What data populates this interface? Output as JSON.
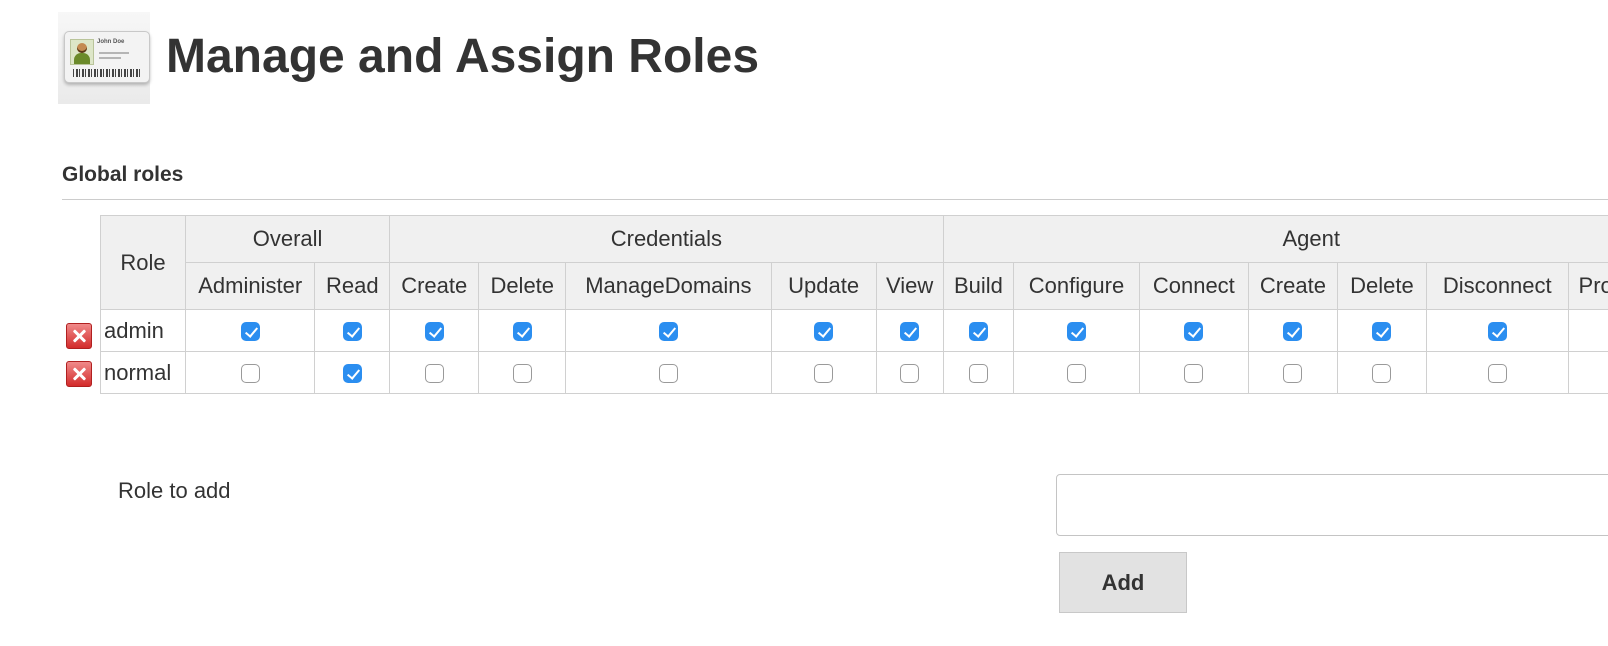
{
  "page": {
    "title": "Manage and Assign Roles"
  },
  "header_icon": {
    "name": "id-card-icon",
    "card_text": "John Doe"
  },
  "global_roles": {
    "title": "Global roles",
    "role_header": "Role",
    "groups": [
      {
        "label": "Overall",
        "span": 2
      },
      {
        "label": "Credentials",
        "span": 5
      },
      {
        "label": "Agent",
        "span": 7
      }
    ],
    "permissions": [
      "Administer",
      "Read",
      "Create",
      "Delete",
      "ManageDomains",
      "Update",
      "View",
      "Build",
      "Configure",
      "Connect",
      "Create",
      "Delete",
      "Disconnect",
      "Provision"
    ],
    "roles": [
      {
        "name": "admin",
        "checked": [
          true,
          true,
          true,
          true,
          true,
          true,
          true,
          true,
          true,
          true,
          true,
          true,
          true,
          true
        ]
      },
      {
        "name": "normal",
        "checked": [
          false,
          true,
          false,
          false,
          false,
          false,
          false,
          false,
          false,
          false,
          false,
          false,
          false,
          false
        ]
      }
    ],
    "remove_icon": "remove-icon",
    "colors": {
      "checked": "#2b8ef0",
      "remove": "#d32b2b",
      "header_bg": "#f0f0f0"
    }
  },
  "add_role": {
    "label": "Role to add",
    "input_value": "",
    "button_label": "Add"
  }
}
